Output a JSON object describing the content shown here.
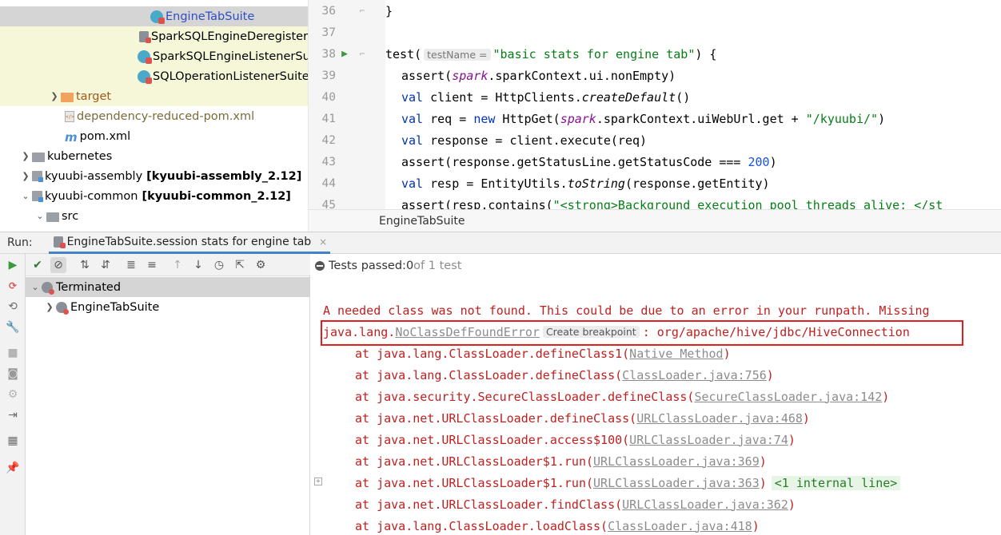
{
  "project_tree": {
    "items": [
      {
        "label": "EngineTabSuite"
      },
      {
        "label": "SparkSQLEngineDeregisterSuite"
      },
      {
        "label": "SparkSQLEngineListenerSuite"
      },
      {
        "label": "SQLOperationListenerSuite"
      },
      {
        "label": "target"
      },
      {
        "label": "dependency-reduced-pom.xml"
      },
      {
        "label": "pom.xml"
      },
      {
        "label": "kubernetes"
      },
      {
        "label": "kyuubi-assembly",
        "suffix": "[kyuubi-assembly_2.12]"
      },
      {
        "label": "kyuubi-common",
        "suffix": "[kyuubi-common_2.12]"
      },
      {
        "label": "src"
      }
    ]
  },
  "editor": {
    "lines": [
      {
        "num": "36",
        "code": "}"
      },
      {
        "num": "37",
        "code": ""
      },
      {
        "num": "38",
        "pre": "test(",
        "hint": "testName =",
        "str": "\"basic stats for engine tab\"",
        "post": ") {"
      },
      {
        "num": "39",
        "pre": "assert(",
        "spark": "spark",
        "post": ".sparkContext.ui.nonEmpty)"
      },
      {
        "num": "40",
        "kw": "val",
        "pre": " client = HttpClients.",
        "ital": "createDefault",
        "post": "()"
      },
      {
        "num": "41",
        "kw": "val",
        "pre": " req = ",
        "kw2": "new",
        "mid": " HttpGet(",
        "spark": "spark",
        "post": ".sparkContext.uiWebUrl.get + ",
        "str": "\"/kyuubi/\"",
        "end": ")"
      },
      {
        "num": "42",
        "kw": "val",
        "pre": " response = client.execute(req)"
      },
      {
        "num": "43",
        "pre": "assert(response.getStatusLine.getStatusCode === ",
        "num_val": "200",
        "post": ")"
      },
      {
        "num": "44",
        "kw": "val",
        "pre": " resp = EntityUtils.",
        "ital": "toString",
        "post": "(response.getEntity)"
      },
      {
        "num": "45",
        "pre": "assert(resp.contains(",
        "str": "\"<strong>Background execution pool threads alive: </st"
      }
    ],
    "breadcrumb": "EngineTabSuite"
  },
  "run": {
    "label": "Run:",
    "tab_title": "EngineTabSuite.session stats for engine tab",
    "tab_close": "×"
  },
  "test_tree": {
    "items": [
      {
        "label": "Terminated"
      },
      {
        "label": "EngineTabSuite"
      }
    ]
  },
  "console": {
    "status_prefix": "Tests passed: ",
    "passed": "0",
    "status_suffix": " of 1 test",
    "message": "A needed class was not found. This could be due to an error in your runpath. Missing",
    "error_class_prefix": "java.lang.",
    "error_class_link": "NoClassDefFoundError",
    "breakpoint_hint": "Create breakpoint",
    "error_rest": ": org/apache/hive/jdbc/HiveConnection",
    "stack": [
      {
        "at": "at java.lang.ClassLoader.defineClass1(",
        "link": "Native Method",
        "end": ")"
      },
      {
        "at": "at java.lang.ClassLoader.defineClass(",
        "link": "ClassLoader.java:756",
        "end": ")"
      },
      {
        "at": "at java.security.SecureClassLoader.defineClass(",
        "link": "SecureClassLoader.java:142",
        "end": ")"
      },
      {
        "at": "at java.net.URLClassLoader.defineClass(",
        "link": "URLClassLoader.java:468",
        "end": ")"
      },
      {
        "at": "at java.net.URLClassLoader.access$100(",
        "link": "URLClassLoader.java:74",
        "end": ")"
      },
      {
        "at": "at java.net.URLClassLoader$1.run(",
        "link": "URLClassLoader.java:369",
        "end": ")"
      },
      {
        "at": "at java.net.URLClassLoader$1.run(",
        "link": "URLClassLoader.java:363",
        "end": ")",
        "extra": "<1 internal line>"
      },
      {
        "at": "at java.net.URLClassLoader.findClass(",
        "link": "URLClassLoader.java:362",
        "end": ")"
      },
      {
        "at": "at java.lang.ClassLoader.loadClass(",
        "link": "ClassLoader.java:418",
        "end": ")"
      }
    ]
  },
  "colors": {
    "error_text": "#c01f1f",
    "highlight_box": "#e02020",
    "keyword": "#0033b3",
    "string": "#067d17",
    "selection": "#d5d5d5",
    "tab_underline": "#4083c9"
  }
}
